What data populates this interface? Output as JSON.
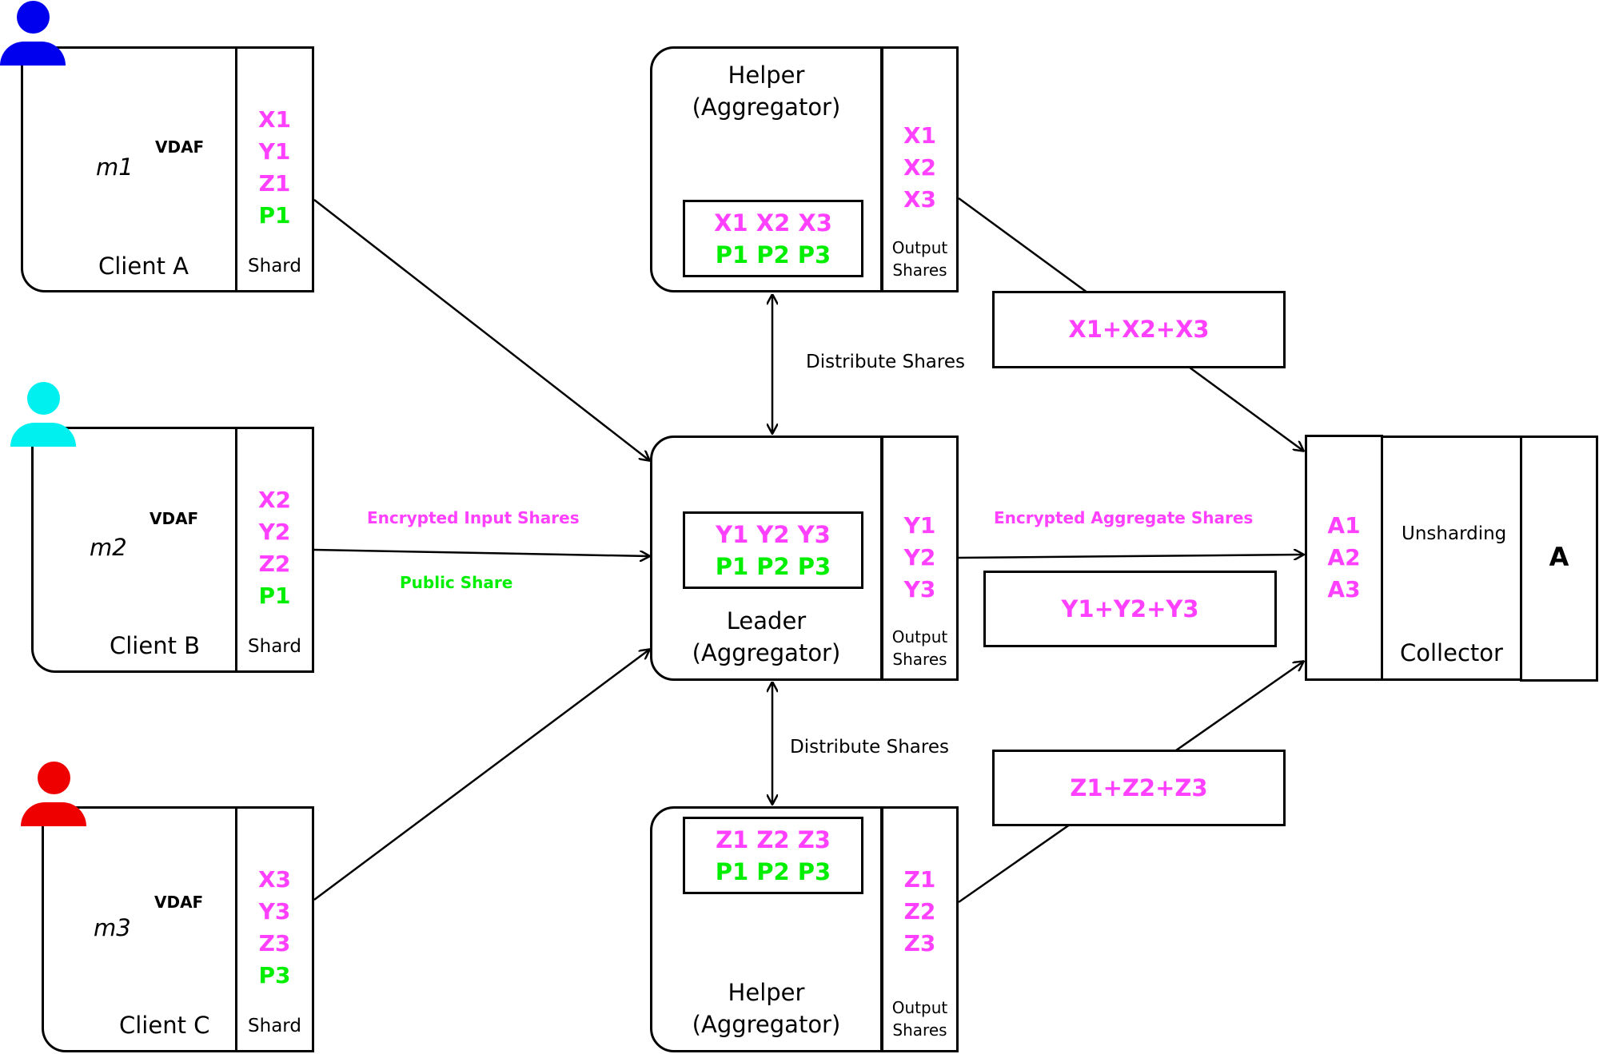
{
  "colors": {
    "share": "#ff40ff",
    "public": "#00ee00",
    "client_a": "#0000ee",
    "client_b": "#00f0f0",
    "client_c": "#ee0000"
  },
  "clients": [
    {
      "name": "Client A",
      "measurement": "m1",
      "algo": "VDAF",
      "shard_label": "Shard",
      "shares": [
        "X1",
        "Y1",
        "Z1"
      ],
      "public": "P1",
      "icon": "person-icon-blue"
    },
    {
      "name": "Client B",
      "measurement": "m2",
      "algo": "VDAF",
      "shard_label": "Shard",
      "shares": [
        "X2",
        "Y2",
        "Z2"
      ],
      "public": "P1",
      "icon": "person-icon-cyan"
    },
    {
      "name": "Client C",
      "measurement": "m3",
      "algo": "VDAF",
      "shard_label": "Shard",
      "shares": [
        "X3",
        "Y3",
        "Z3"
      ],
      "public": "P3",
      "icon": "person-icon-red"
    }
  ],
  "aggregators": {
    "helper_top": {
      "title": "Helper",
      "subtitle": "(Aggregator)",
      "inputs": "X1 X2 X3",
      "publics": "P1 P2 P3",
      "outputs": [
        "X1",
        "X2",
        "X3"
      ],
      "output_label_1": "Output",
      "output_label_2": "Shares"
    },
    "leader": {
      "title": "Leader",
      "subtitle": "(Aggregator)",
      "inputs": "Y1 Y2 Y3",
      "publics": "P1 P2 P3",
      "outputs": [
        "Y1",
        "Y2",
        "Y3"
      ],
      "output_label_1": "Output",
      "output_label_2": "Shares"
    },
    "helper_bottom": {
      "title": "Helper",
      "subtitle": "(Aggregator)",
      "inputs": "Z1 Z2 Z3",
      "publics": "P1 P2 P3",
      "outputs": [
        "Z1",
        "Z2",
        "Z3"
      ],
      "output_label_1": "Output",
      "output_label_2": "Shares"
    }
  },
  "edges": {
    "encrypted_input_shares": "Encrypted Input Shares",
    "public_share": "Public Share",
    "distribute_shares_top": "Distribute Shares",
    "distribute_shares_bottom": "Distribute Shares",
    "encrypted_aggregate_shares": "Encrypted Aggregate Shares"
  },
  "aggregate_sums": {
    "x": "X1+X2+X3",
    "y": "Y1+Y2+Y3",
    "z": "Z1+Z2+Z3"
  },
  "collector": {
    "inputs": [
      "A1",
      "A2",
      "A3"
    ],
    "step": "Unsharding",
    "title": "Collector",
    "result": "A"
  }
}
